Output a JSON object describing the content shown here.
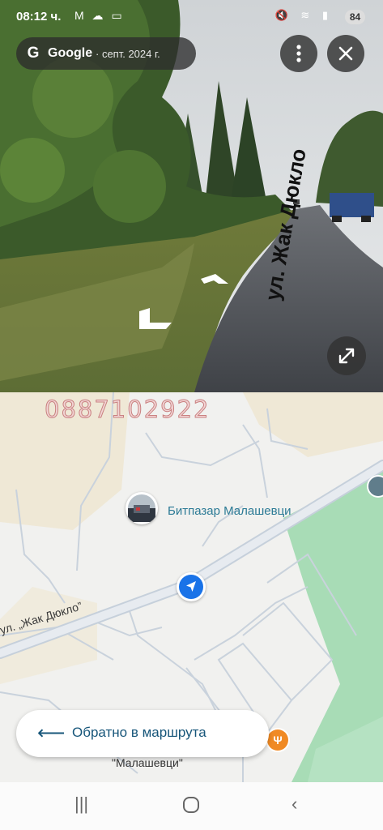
{
  "status_bar": {
    "time": "08:12 ч.",
    "left_icons": "M ☁ ▭",
    "right_icons": "🔇 ≋ ▮",
    "battery": "84"
  },
  "street_view": {
    "brand": "Google",
    "date": "· септ. 2024 г.",
    "logo_letter": "G",
    "road_text": "ул. Жак Дюкло"
  },
  "map": {
    "overlay_phone": "0887102922",
    "poi_name": "Битпазар Малашевци",
    "street_name": "ул. „Жак Дюкло”",
    "bottom_label": "\"Малашевци\""
  },
  "back_button": {
    "label": "Обратно в маршрута"
  },
  "colors": {
    "accent_blue": "#1a73e8",
    "poi_text": "#2b7a95",
    "park_green": "#a8dcb6",
    "restaurant_orange": "#f08a24"
  },
  "icons": {
    "more": "more-vert-icon",
    "close": "close-icon",
    "expand": "expand-icon",
    "back": "arrow-left-icon",
    "navigation": "navigation-arrow-icon",
    "restaurant": "fork-knife-icon"
  }
}
